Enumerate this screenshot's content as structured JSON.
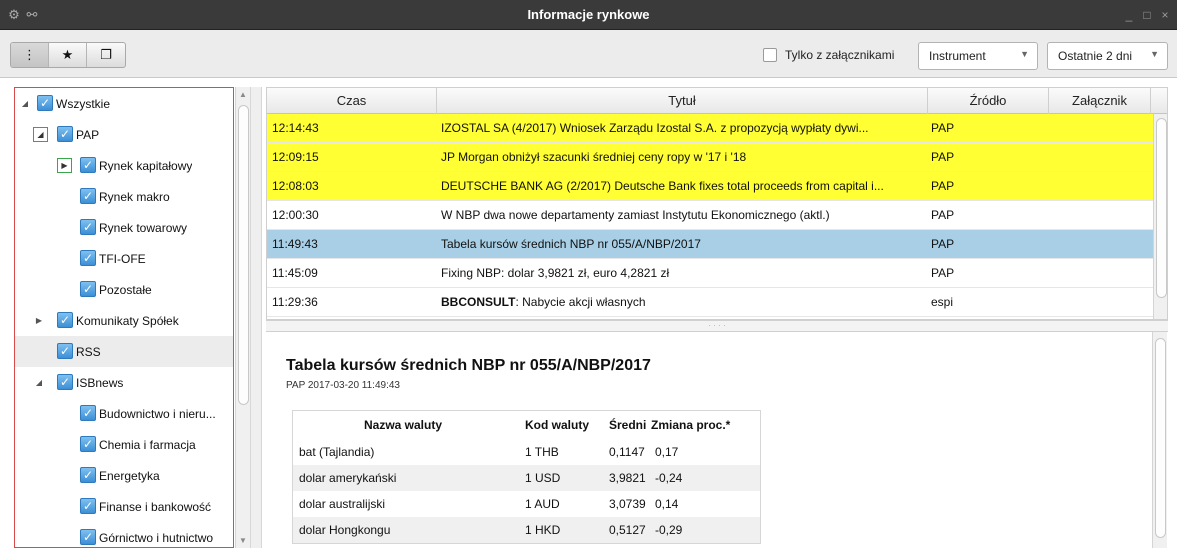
{
  "window": {
    "title": "Informacje rynkowe"
  },
  "toolbar": {
    "attachments_only_label": "Tylko z załącznikami",
    "instrument_select": "Instrument",
    "period_select": "Ostatnie 2 dni"
  },
  "tree": [
    {
      "label": "Wszystkie",
      "level": 0,
      "expanded": true
    },
    {
      "label": "PAP",
      "level": 1,
      "expanded": true
    },
    {
      "label": "Rynek kapitałowy",
      "level": 2,
      "expanded": false
    },
    {
      "label": "Rynek makro",
      "level": 2
    },
    {
      "label": "Rynek towarowy",
      "level": 2
    },
    {
      "label": "TFI-OFE",
      "level": 2
    },
    {
      "label": "Pozostałe",
      "level": 2
    },
    {
      "label": "Komunikaty Spółek",
      "level": 1,
      "expanded": false
    },
    {
      "label": "RSS",
      "level": 1
    },
    {
      "label": "ISBnews",
      "level": 1,
      "expanded": true
    },
    {
      "label": "Budownictwo i nieru...",
      "level": 2
    },
    {
      "label": "Chemia i farmacja",
      "level": 2
    },
    {
      "label": "Energetyka",
      "level": 2
    },
    {
      "label": "Finanse i bankowość",
      "level": 2
    },
    {
      "label": "Górnictwo i hutnictwo",
      "level": 2
    }
  ],
  "news": {
    "columns": [
      "Czas",
      "Tytuł",
      "Źródło",
      "Załącznik"
    ],
    "rows": [
      {
        "time": "12:14:43",
        "title": "IZOSTAL SA (4/2017) Wniosek Zarządu Izostal S.A. z propozycją wypłaty dywi...",
        "source": "PAP",
        "attachment": "",
        "highlight": true
      },
      {
        "time": "12:09:15",
        "title": "JP Morgan obniżył szacunki średniej ceny ropy w '17 i '18",
        "source": "PAP",
        "attachment": "",
        "highlight": true
      },
      {
        "time": "12:08:03",
        "title": "DEUTSCHE BANK AG (2/2017) Deutsche Bank fixes total proceeds from capital i...",
        "source": "PAP",
        "attachment": "",
        "highlight": true
      },
      {
        "time": "12:00:30",
        "title": "W NBP dwa nowe departamenty zamiast Instytutu Ekonomicznego (aktl.)",
        "source": "PAP",
        "attachment": ""
      },
      {
        "time": "11:49:43",
        "title": "Tabela kursów średnich NBP nr 055/A/NBP/2017",
        "source": "PAP",
        "attachment": "",
        "selected": true
      },
      {
        "time": "11:45:09",
        "title": "Fixing NBP: dolar 3,9821 zł, euro 4,2821 zł",
        "source": "PAP",
        "attachment": ""
      },
      {
        "time": "11:29:36",
        "title_bold": "BBCONSULT",
        "title": ": Nabycie akcji własnych",
        "source": "espi",
        "attachment": ""
      }
    ]
  },
  "article": {
    "title": "Tabela kursów średnich NBP nr 055/A/NBP/2017",
    "meta": "PAP 2017-03-20 11:49:43",
    "table": {
      "headers": [
        "Nazwa waluty",
        "Kod waluty",
        "Średni",
        "Zmiana proc.*"
      ],
      "rows": [
        [
          "bat (Tajlandia)",
          "1 THB",
          "0,1147",
          "0,17"
        ],
        [
          "dolar amerykański",
          "1 USD",
          "3,9821",
          "-0,24"
        ],
        [
          "dolar australijski",
          "1 AUD",
          "3,0739",
          "0,14"
        ],
        [
          "dolar Hongkongu",
          "1 HKD",
          "0,5127",
          "-0,29"
        ]
      ]
    }
  },
  "colors": {
    "highlight_row": "#ffff33",
    "selected_row": "#a8cfe6",
    "titlebar": "#3a3a3a",
    "tree_border": "#d94a4a"
  }
}
